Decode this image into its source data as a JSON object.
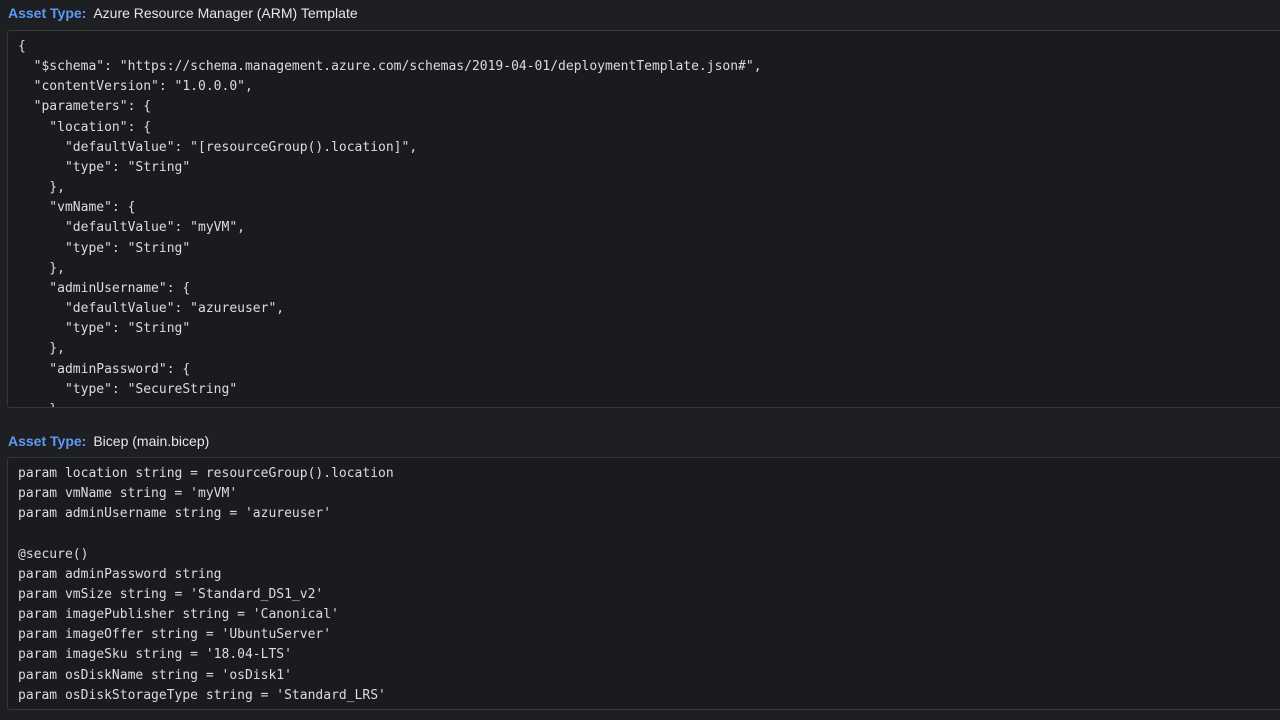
{
  "assets": [
    {
      "label": "Asset Type:",
      "value": "Azure Resource Manager (ARM) Template",
      "code": "{\n  \"$schema\": \"https://schema.management.azure.com/schemas/2019-04-01/deploymentTemplate.json#\",\n  \"contentVersion\": \"1.0.0.0\",\n  \"parameters\": {\n    \"location\": {\n      \"defaultValue\": \"[resourceGroup().location]\",\n      \"type\": \"String\"\n    },\n    \"vmName\": {\n      \"defaultValue\": \"myVM\",\n      \"type\": \"String\"\n    },\n    \"adminUsername\": {\n      \"defaultValue\": \"azureuser\",\n      \"type\": \"String\"\n    },\n    \"adminPassword\": {\n      \"type\": \"SecureString\"\n    }"
    },
    {
      "label": "Asset Type:",
      "value": "Bicep (main.bicep)",
      "code": "param location string = resourceGroup().location\nparam vmName string = 'myVM'\nparam adminUsername string = 'azureuser'\n\n@secure()\nparam adminPassword string\nparam vmSize string = 'Standard_DS1_v2'\nparam imagePublisher string = 'Canonical'\nparam imageOffer string = 'UbuntuServer'\nparam imageSku string = '18.04-LTS'\nparam osDiskName string = 'osDisk1'\nparam osDiskStorageType string = 'Standard_LRS'"
    }
  ]
}
